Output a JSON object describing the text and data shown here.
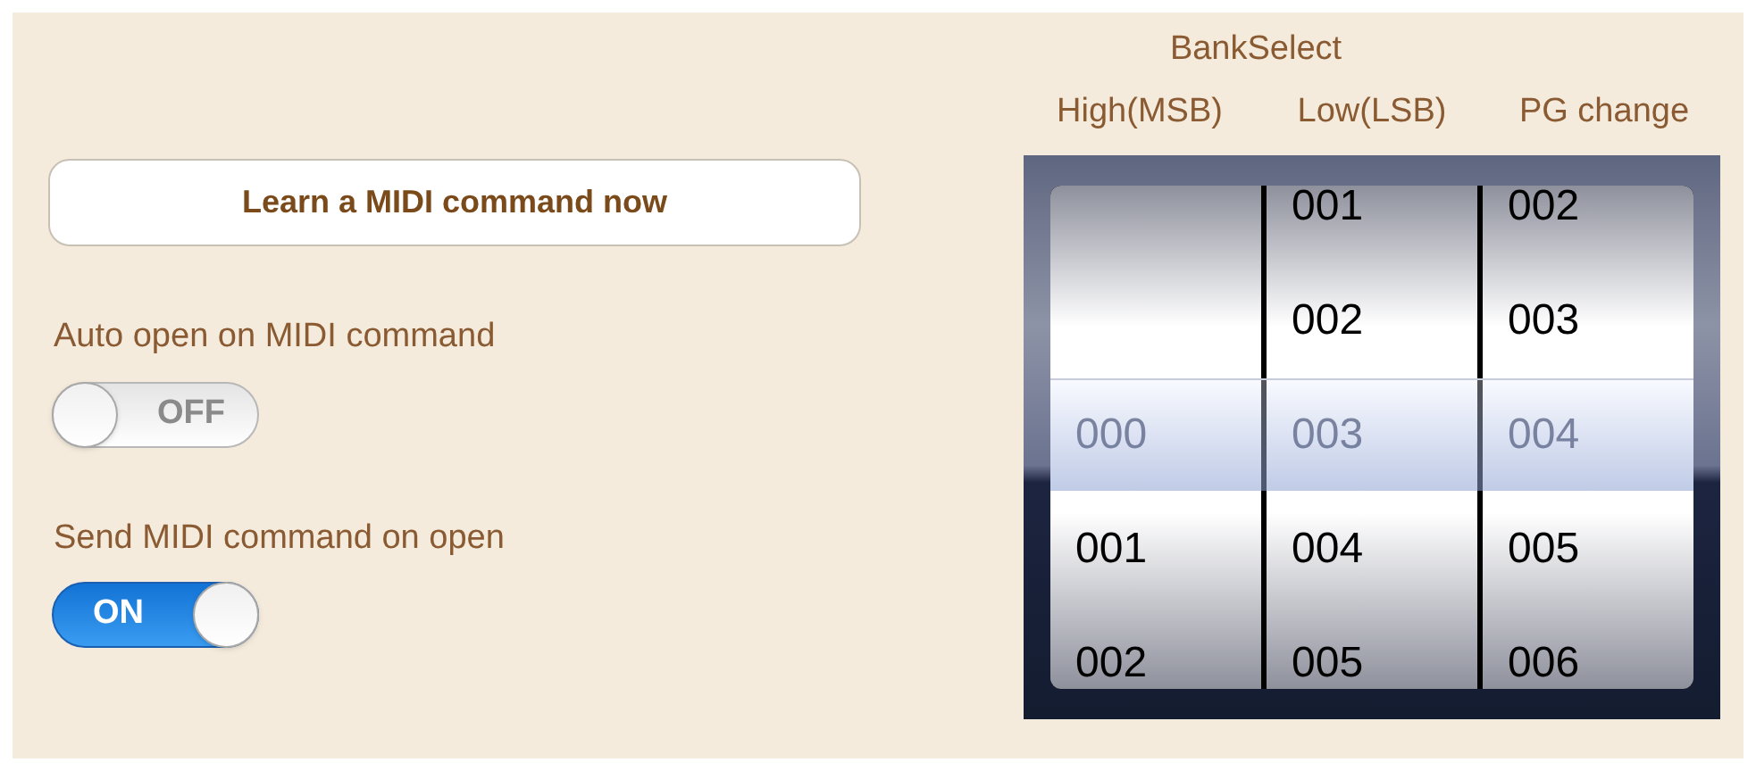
{
  "learn_button": {
    "label": "Learn a MIDI command now"
  },
  "toggles": [
    {
      "label": "Auto open on MIDI command",
      "on": false,
      "state_text": "OFF"
    },
    {
      "label": "Send MIDI command on open",
      "on": true,
      "state_text": "ON"
    }
  ],
  "picker": {
    "group_title": "BankSelect",
    "columns": [
      {
        "title": "High(MSB)",
        "items": [
          {
            "value": "000",
            "selected": true
          },
          {
            "value": "001",
            "selected": false
          },
          {
            "value": "002",
            "selected": false
          }
        ]
      },
      {
        "title": "Low(LSB)",
        "items": [
          {
            "value": "001",
            "selected": false
          },
          {
            "value": "002",
            "selected": false
          },
          {
            "value": "003",
            "selected": true
          },
          {
            "value": "004",
            "selected": false
          },
          {
            "value": "005",
            "selected": false
          }
        ]
      },
      {
        "title": "PG change",
        "items": [
          {
            "value": "002",
            "selected": false
          },
          {
            "value": "003",
            "selected": false
          },
          {
            "value": "004",
            "selected": true
          },
          {
            "value": "005",
            "selected": false
          },
          {
            "value": "006",
            "selected": false
          }
        ]
      }
    ]
  }
}
